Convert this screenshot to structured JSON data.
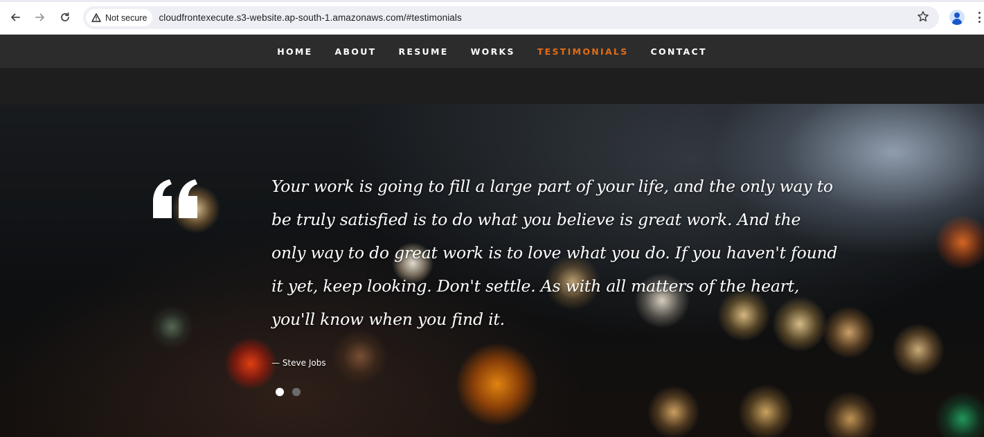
{
  "browser": {
    "back_icon": "arrow-left",
    "forward_icon": "arrow-right",
    "reload_icon": "reload",
    "security_label": "Not secure",
    "url": "cloudfrontexecute.s3-website.ap-south-1.amazonaws.com/#testimonials",
    "bookmark_icon": "star-outline",
    "profile_icon": "person",
    "menu_icon": "kebab-vertical"
  },
  "nav": {
    "items": [
      {
        "label": "HOME",
        "active": false
      },
      {
        "label": "ABOUT",
        "active": false
      },
      {
        "label": "RESUME",
        "active": false
      },
      {
        "label": "WORKS",
        "active": false
      },
      {
        "label": "TESTIMONIALS",
        "active": true
      },
      {
        "label": "CONTACT",
        "active": false
      }
    ],
    "active_color": "#e06d17"
  },
  "testimonial": {
    "quote_icon": "quote-left",
    "text": "Your work is going to fill a large part of your life, and the only way to be truly satisfied is to do what you believe is great work. And the only way to do great work is to love what you do. If you haven't found it yet, keep looking. Don't settle. As with all matters of the heart, you'll know when you find it.",
    "author": "— Steve Jobs",
    "slides": 2,
    "active_slide": 1
  }
}
